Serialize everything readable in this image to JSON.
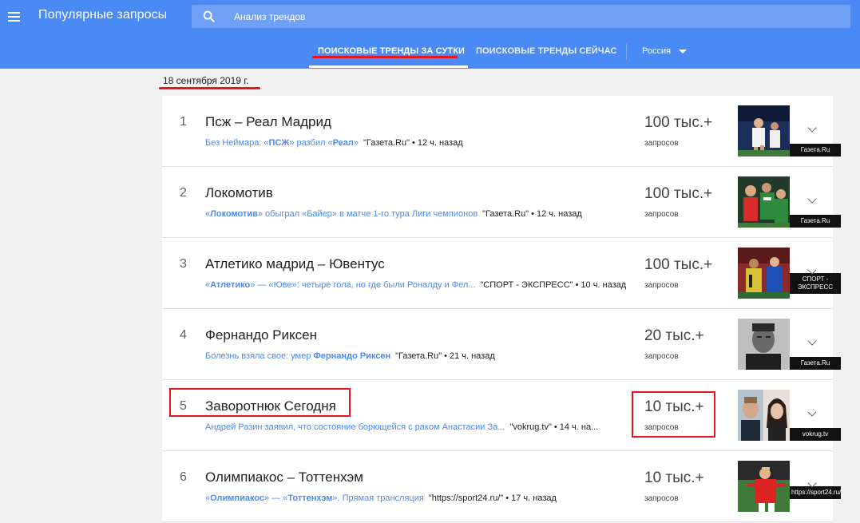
{
  "header": {
    "title": "Популярные запросы",
    "search_placeholder": "Анализ трендов"
  },
  "tabs": [
    {
      "label": "ПОИСКОВЫЕ ТРЕНДЫ ЗА СУТКИ",
      "active": true
    },
    {
      "label": "ПОИСКОВЫЕ ТРЕНДЫ СЕЙЧАС",
      "active": false
    }
  ],
  "region": "Россия",
  "date": "18 сентября 2019 г.",
  "colors": {
    "appbar": "#4a8af4",
    "accent_link": "#4a8af4",
    "highlight": "#e4171f"
  },
  "trends": [
    {
      "rank": "1",
      "title": "Псж – Реал Мадрид",
      "headline_parts": [
        [
          "Без Неймара: «",
          false
        ],
        [
          "ПСЖ",
          true
        ],
        [
          "» разбил «",
          false
        ],
        [
          "Реал",
          true
        ],
        [
          "»",
          false
        ]
      ],
      "source": "\"Газета.Ru\"",
      "ago": "12 ч. назад",
      "count": "100 тыс.+",
      "count_label": "запросов",
      "thumb_caption": "Газета.Ru",
      "thumb_icon": "football-photo-icon"
    },
    {
      "rank": "2",
      "title": "Локомотив",
      "headline_parts": [
        [
          "«",
          false
        ],
        [
          "Локомотив",
          true
        ],
        [
          "» обыграл «Байер» в матче 1-го тура Лиги чемпионов",
          false
        ]
      ],
      "source": "\"Газета.Ru\"",
      "ago": "12 ч. назад",
      "count": "100 тыс.+",
      "count_label": "запросов",
      "thumb_caption": "Газета.Ru",
      "thumb_icon": "team-celebration-photo-icon"
    },
    {
      "rank": "3",
      "title": "Атлетико мадрид – Ювентус",
      "headline_parts": [
        [
          "«",
          false
        ],
        [
          "Атлетико",
          true
        ],
        [
          "» — «Юве»: четыре гола, но где были Роналду и Фел...",
          false
        ]
      ],
      "source": "\"СПОРТ - ЭКСПРЕСС\"",
      "ago": "10 ч. назад",
      "count": "100 тыс.+",
      "count_label": "запросов",
      "thumb_caption": "СПОРТ - ЭКСПРЕСС",
      "thumb_icon": "players-photo-icon"
    },
    {
      "rank": "4",
      "title": "Фернандо Риксен",
      "headline_parts": [
        [
          "Болезнь взяла свое: умер ",
          false
        ],
        [
          "Фернандо Риксен",
          true
        ]
      ],
      "source": "\"Газета.Ru\"",
      "ago": "21 ч. назад",
      "count": "20 тыс.+",
      "count_label": "запросов",
      "thumb_caption": "Газета.Ru",
      "thumb_icon": "portrait-photo-icon"
    },
    {
      "rank": "5",
      "title": "Заворотнюк Сегодня",
      "headline_parts": [
        [
          "Андрей Разин заявил, что состояние борющейся с раком Анастасии За...",
          false
        ]
      ],
      "source": "\"vokrug.tv\"",
      "ago": "14 ч. на...",
      "count": "10 тыс.+",
      "count_label": "запросов",
      "thumb_caption": "vokrug.tv",
      "thumb_icon": "two-people-photo-icon"
    },
    {
      "rank": "6",
      "title": "Олимпиакос – Тоттенхэм",
      "headline_parts": [
        [
          "«",
          false
        ],
        [
          "Олимпиакос",
          true
        ],
        [
          "» — «",
          false
        ],
        [
          "Тоттенхэм",
          true
        ],
        [
          "». Прямая трансляция",
          false
        ]
      ],
      "source": "\"https://sport24.ru/\"",
      "ago": "17 ч. назад",
      "count": "10 тыс.+",
      "count_label": "запросов",
      "thumb_caption": "https://sport24.ru/",
      "thumb_icon": "player-red-kit-photo-icon"
    }
  ]
}
